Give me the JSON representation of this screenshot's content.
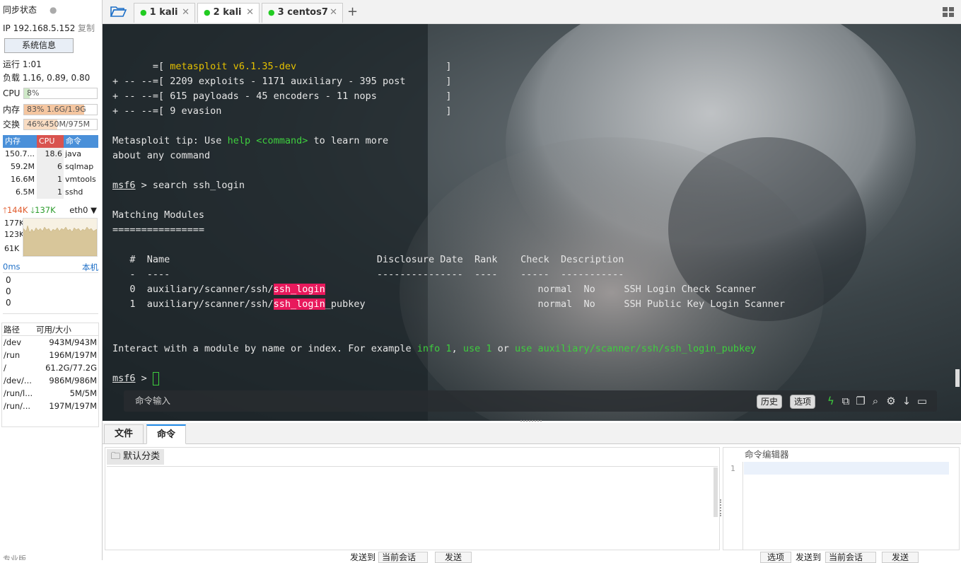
{
  "sidebar": {
    "sync_label": "同步状态",
    "ip": "IP 192.168.5.152",
    "copy": "复制",
    "sysinfo": "系统信息",
    "uptime": "运行 1:01",
    "load": "负载 1.16, 0.89, 0.80",
    "cpu_label": "CPU",
    "cpu_val": "8%",
    "cpu_pct": 8,
    "mem_label": "内存",
    "mem_val": "83%   1.6G/1.9G",
    "mem_pct": 83,
    "swap_label": "交换",
    "swap_val": "46%450M/975M",
    "swap_pct": 46,
    "proc_headers": [
      "内存",
      "CPU",
      "命令"
    ],
    "processes": [
      {
        "mem": "150.7...",
        "cpu": "18.6",
        "cmd": "java"
      },
      {
        "mem": "59.2M",
        "cpu": "6",
        "cmd": "sqlmap"
      },
      {
        "mem": "16.6M",
        "cpu": "1",
        "cmd": "vmtools"
      },
      {
        "mem": "6.5M",
        "cpu": "1",
        "cmd": "sshd"
      }
    ],
    "net_up": "144K",
    "net_down": "137K",
    "net_iface": "eth0",
    "net_scale": [
      "177K",
      "123K",
      "61K"
    ],
    "latency": "0ms",
    "latency_host": "本机",
    "latency_vals": [
      "0",
      "0",
      "0"
    ],
    "disk_headers": [
      "路径",
      "可用/大小"
    ],
    "disks": [
      {
        "path": "/dev",
        "size": "943M/943M"
      },
      {
        "path": "/run",
        "size": "196M/197M"
      },
      {
        "path": "/",
        "size": "61.2G/77.2G"
      },
      {
        "path": "/dev/...",
        "size": "986M/986M"
      },
      {
        "path": "/run/l...",
        "size": "5M/5M"
      },
      {
        "path": "/run/...",
        "size": "197M/197M"
      }
    ],
    "bottom_text": "专业版"
  },
  "tabs": [
    {
      "num": "1",
      "name": "kali"
    },
    {
      "num": "2",
      "name": "kali"
    },
    {
      "num": "3",
      "name": "centos7"
    }
  ],
  "terminal": {
    "banner": {
      "prefix": "       =[ ",
      "version": "metasploit v6.1.35-dev",
      "suffix": "                          ]"
    },
    "banner_lines": [
      "+ -- --=[ 2209 exploits - 1171 auxiliary - 395 post       ]",
      "+ -- --=[ 615 payloads - 45 encoders - 11 nops            ]",
      "+ -- --=[ 9 evasion                                       ]"
    ],
    "tip_pre": "Metasploit tip: Use ",
    "tip_cmd": "help <command>",
    "tip_post": " to learn more",
    "tip_line2": "about any command",
    "prompt": "msf6",
    "cmd": " > search ssh_login",
    "matching": "Matching Modules",
    "rule": "================",
    "col_header": "   #  Name                                    Disclosure Date  Rank    Check  Description",
    "col_rule": "   -  ----                                    ---------------  ----    -----  -----------",
    "result0": {
      "pre": "   0  auxiliary/scanner/ssh/",
      "hl": "ssh_login",
      "post": "                                     normal  No     SSH Login Check Scanner"
    },
    "result1": {
      "pre": "   1  auxiliary/scanner/ssh/",
      "hl": "ssh_login",
      "post": "_pubkey                              normal  No     SSH Public Key Login Scanner"
    },
    "interact_pre": "Interact with a module by name or index. For example ",
    "interact_a": "info 1",
    "interact_sep1": ", ",
    "interact_b": "use 1",
    "interact_or": " or ",
    "interact_c": "use auxiliary/scanner/ssh/ssh_login_pubkey",
    "prompt2_tail": " > "
  },
  "cmdbar": {
    "placeholder": "命令输入",
    "history": "历史",
    "options": "选项"
  },
  "bottom_tabs": [
    "文件",
    "命令"
  ],
  "commands": {
    "category": "默认分类",
    "editor_title": "命令编辑器",
    "line_no": "1"
  },
  "footer": {
    "send_to": "发送到",
    "current": "当前会话",
    "send": "发送",
    "options": "选项",
    "send_to2": "发送到",
    "current2": "当前会话",
    "send2": "发送"
  },
  "colors": {
    "highlight": "#e8195c",
    "prompt_green": "#3ecf3e",
    "version_yellow": "#e4c000",
    "accent_blue": "#1e88e5"
  }
}
